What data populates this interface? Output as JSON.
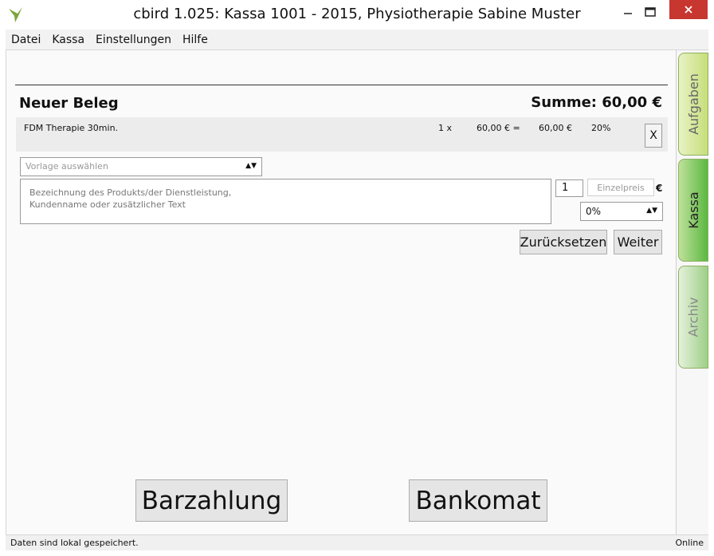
{
  "window": {
    "title": "cbird 1.025: Kassa 1001 - 2015, Physiotherapie Sabine Muster"
  },
  "menu": [
    "Datei",
    "Kassa",
    "Einstellungen",
    "Hilfe"
  ],
  "beleg": {
    "title": "Neuer Beleg",
    "summe": "Summe: 60,00 €"
  },
  "items": [
    {
      "name": "FDM Therapie 30min.",
      "qty": "1 x",
      "price": "60,00 € =",
      "total": "60,00 €",
      "tax": "20%",
      "delete_label": "X"
    }
  ],
  "form": {
    "vorlage_placeholder": "Vorlage auswählen",
    "description_placeholder_line1": "Bezeichnung des Produkts/der Dienstleistung,",
    "description_placeholder_line2": "Kundenname oder zusätzlicher Text",
    "quantity": "1",
    "einzelpreis_placeholder": "Einzelpreis",
    "currency": "€",
    "tax_selected": "0%"
  },
  "buttons": {
    "reset": "Zurücksetzen",
    "next": "Weiter",
    "cash": "Barzahlung",
    "card": "Bankomat"
  },
  "status": {
    "left": "Daten sind lokal gespeichert.",
    "right": "Online"
  },
  "tabs": [
    "Aufgaben",
    "Kassa",
    "Archiv"
  ],
  "colors": {
    "close_button": "#c7372f",
    "tab_active": "#5bb842",
    "tab_light": "#c6de7a"
  }
}
